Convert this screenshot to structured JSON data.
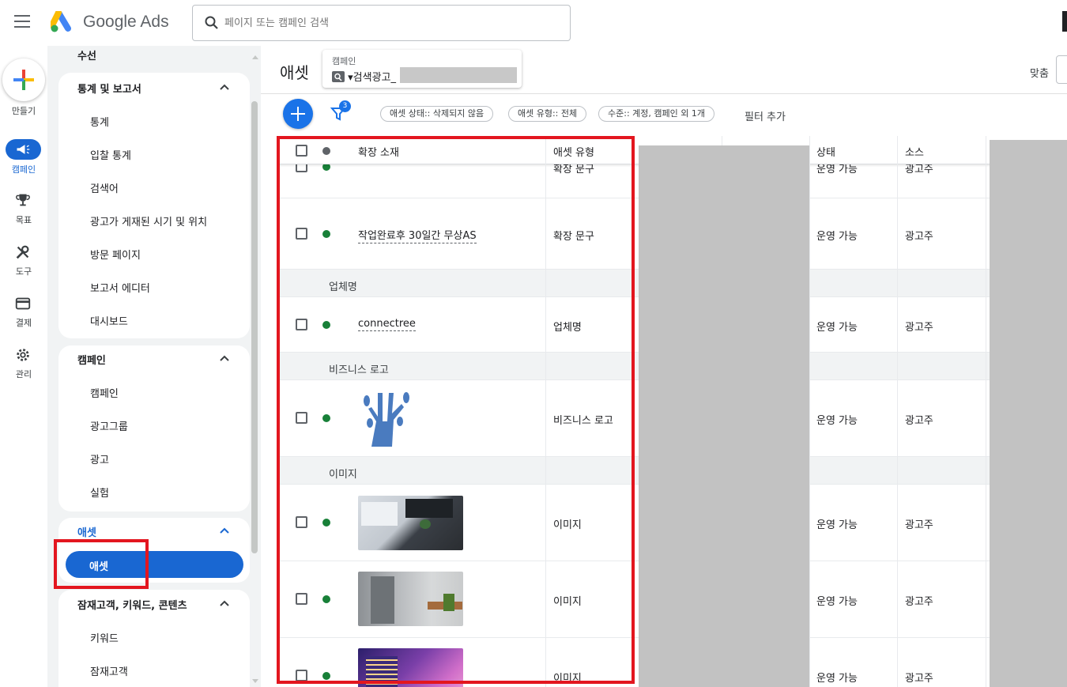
{
  "app": {
    "logo_text": "Google Ads"
  },
  "search": {
    "placeholder": "페이지 또는 캠페인 검색"
  },
  "rail": {
    "create": "만들기",
    "items": [
      {
        "label": "캠페인",
        "icon": "megaphone-icon"
      },
      {
        "label": "목표",
        "icon": "trophy-icon"
      },
      {
        "label": "도구",
        "icon": "tools-icon"
      },
      {
        "label": "결제",
        "icon": "credit-card-icon"
      },
      {
        "label": "관리",
        "icon": "gear-icon"
      }
    ]
  },
  "sidebar": {
    "partial_top": "수선",
    "sections": [
      {
        "title": "통계 및 보고서",
        "items": [
          "통계",
          "입찰 통계",
          "검색어",
          "광고가 게재된 시기 및 위치",
          "방문 페이지",
          "보고서 에디터",
          "대시보드"
        ]
      },
      {
        "title": "캠페인",
        "items": [
          "캠페인",
          "광고그룹",
          "광고",
          "실험"
        ]
      },
      {
        "title": "애셋",
        "items": [
          "애셋"
        ]
      },
      {
        "title": "잠재고객, 키워드, 콘텐츠",
        "items": [
          "키워드",
          "잠재고객"
        ]
      }
    ]
  },
  "main": {
    "title": "애셋",
    "campaign_selector": {
      "label": "캠페인",
      "value": "▾검색광고_"
    },
    "fit_label": "맞춤",
    "filter_count": "3",
    "filters": [
      "애셋 상태:: 삭제되지 않음",
      "애셋 유형:: 전체",
      "수준:: 계정, 캠페인 외 1개"
    ],
    "add_filter": "필터 추가"
  },
  "table": {
    "headers": {
      "asset": "확장 소재",
      "type": "애셋 유형",
      "status": "상태",
      "source": "소스"
    },
    "partial_row": {
      "asset": "",
      "type": "확장 문구",
      "status": "운영 가능",
      "source": "광고주"
    },
    "rows": [
      {
        "asset": "작업완료후 30일간 무상AS",
        "type": "확장 문구",
        "status": "운영 가능",
        "source": "광고주"
      }
    ],
    "groups": [
      {
        "label": "업체명",
        "rows": [
          {
            "asset": "connectree",
            "type": "업체명",
            "status": "운영 가능",
            "source": "광고주"
          }
        ]
      },
      {
        "label": "비즈니스 로고",
        "rows": [
          {
            "asset": "",
            "type": "비즈니스 로고",
            "status": "운영 가능",
            "source": "광고주"
          }
        ]
      },
      {
        "label": "이미지",
        "rows": [
          {
            "asset": "",
            "type": "이미지",
            "status": "운영 가능",
            "source": "광고주"
          },
          {
            "asset": "",
            "type": "이미지",
            "status": "운영 가능",
            "source": "광고주"
          },
          {
            "asset": "",
            "type": "이미지",
            "status": "운영 가능",
            "source": "광고주"
          }
        ]
      }
    ]
  },
  "colors": {
    "accent": "#1967d2",
    "status_green": "#188038",
    "highlight_red": "#e3161f"
  }
}
